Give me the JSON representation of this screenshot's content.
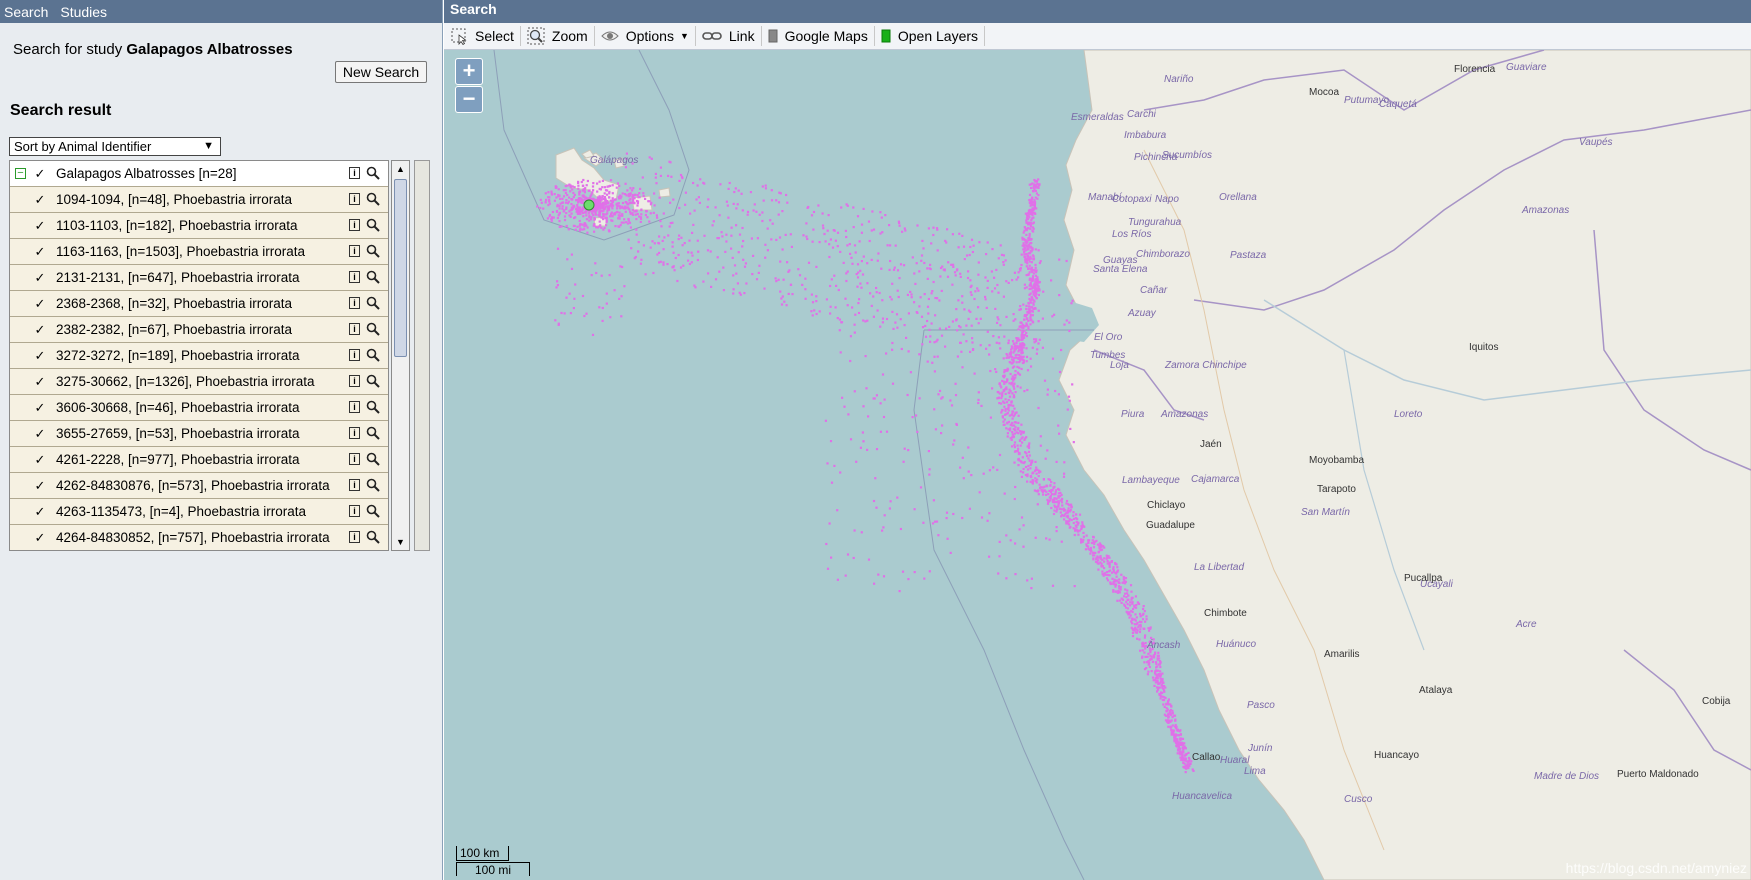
{
  "left_header": {
    "menu": [
      "Search",
      "Studies"
    ]
  },
  "search": {
    "prefix": "Search for study",
    "study_name": "Galapagos Albatrosses",
    "new_search_label": "New Search",
    "result_heading": "Search result",
    "sort_selected": "Sort by Animal Identifier"
  },
  "tree": {
    "root": "Galapagos Albatrosses [n=28]",
    "items": [
      "1094-1094, [n=48], Phoebastria irrorata",
      "1103-1103, [n=182], Phoebastria irrorata",
      "1163-1163, [n=1503], Phoebastria irrorata",
      "2131-2131, [n=647], Phoebastria irrorata",
      "2368-2368, [n=32], Phoebastria irrorata",
      "2382-2382, [n=67], Phoebastria irrorata",
      "3272-3272, [n=189], Phoebastria irrorata",
      "3275-30662, [n=1326], Phoebastria irrorata",
      "3606-30668, [n=46], Phoebastria irrorata",
      "3655-27659, [n=53], Phoebastria irrorata",
      "4261-2228, [n=977], Phoebastria irrorata",
      "4262-84830876, [n=573], Phoebastria irrorata",
      "4263-1135473, [n=4], Phoebastria irrorata",
      "4264-84830852, [n=757], Phoebastria irrorata"
    ]
  },
  "right_header": {
    "title": "Search"
  },
  "toolbar": {
    "select": "Select",
    "zoom": "Zoom",
    "options": "Options",
    "link": "Link",
    "google_maps": "Google Maps",
    "open_layers": "Open Layers"
  },
  "map": {
    "zoom_in": "+",
    "zoom_out": "−",
    "scale_km": "100 km",
    "scale_mi": "100 mi",
    "watermark": "https://blog.csdn.net/amyniez",
    "track_color": "#e070e8",
    "province_labels": [
      "Galápagos",
      "Nariño",
      "Putumayo",
      "Caquetá",
      "Guaviare",
      "Vaupés",
      "Amazonas",
      "Esmeraldas",
      "Carchi",
      "Imbabura",
      "Sucumbíos",
      "Pichincha",
      "Manabí",
      "Cotopaxi",
      "Napo",
      "Orellana",
      "Los Ríos",
      "Tungurahua",
      "Chimborazo",
      "Santa Elena",
      "Pastaza",
      "Guayas",
      "Cañar",
      "Azuay",
      "El Oro",
      "Tumbes",
      "Loja",
      "Zamora Chinchipe",
      "Amazonas",
      "Piura",
      "Loreto",
      "Cajamarca",
      "Lambayeque",
      "San Martín",
      "La Libertad",
      "Ucayali",
      "Áncash",
      "Huánuco",
      "Pasco",
      "Acre",
      "Junín",
      "Huaral",
      "Lima",
      "Huancavelica",
      "Cusco",
      "Madre de Dios"
    ],
    "city_labels": [
      "Florencia",
      "Mocoa",
      "Iquitos",
      "Jaén",
      "Moyobamba",
      "Tarapoto",
      "Chiclayo",
      "Guadalupe",
      "Chimbote",
      "Pucallpa",
      "Amarilis",
      "Atalaya",
      "Huancayo",
      "Callao",
      "Cobija",
      "Puerto Maldonado"
    ]
  }
}
